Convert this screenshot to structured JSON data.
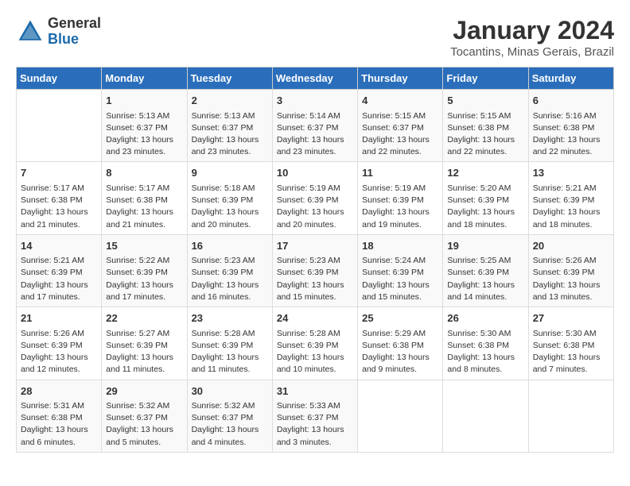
{
  "header": {
    "logo_line1": "General",
    "logo_line2": "Blue",
    "title": "January 2024",
    "subtitle": "Tocantins, Minas Gerais, Brazil"
  },
  "days_of_week": [
    "Sunday",
    "Monday",
    "Tuesday",
    "Wednesday",
    "Thursday",
    "Friday",
    "Saturday"
  ],
  "weeks": [
    [
      {
        "day": "",
        "detail": ""
      },
      {
        "day": "1",
        "detail": "Sunrise: 5:13 AM\nSunset: 6:37 PM\nDaylight: 13 hours\nand 23 minutes."
      },
      {
        "day": "2",
        "detail": "Sunrise: 5:13 AM\nSunset: 6:37 PM\nDaylight: 13 hours\nand 23 minutes."
      },
      {
        "day": "3",
        "detail": "Sunrise: 5:14 AM\nSunset: 6:37 PM\nDaylight: 13 hours\nand 23 minutes."
      },
      {
        "day": "4",
        "detail": "Sunrise: 5:15 AM\nSunset: 6:37 PM\nDaylight: 13 hours\nand 22 minutes."
      },
      {
        "day": "5",
        "detail": "Sunrise: 5:15 AM\nSunset: 6:38 PM\nDaylight: 13 hours\nand 22 minutes."
      },
      {
        "day": "6",
        "detail": "Sunrise: 5:16 AM\nSunset: 6:38 PM\nDaylight: 13 hours\nand 22 minutes."
      }
    ],
    [
      {
        "day": "7",
        "detail": "Sunrise: 5:17 AM\nSunset: 6:38 PM\nDaylight: 13 hours\nand 21 minutes."
      },
      {
        "day": "8",
        "detail": "Sunrise: 5:17 AM\nSunset: 6:38 PM\nDaylight: 13 hours\nand 21 minutes."
      },
      {
        "day": "9",
        "detail": "Sunrise: 5:18 AM\nSunset: 6:39 PM\nDaylight: 13 hours\nand 20 minutes."
      },
      {
        "day": "10",
        "detail": "Sunrise: 5:19 AM\nSunset: 6:39 PM\nDaylight: 13 hours\nand 20 minutes."
      },
      {
        "day": "11",
        "detail": "Sunrise: 5:19 AM\nSunset: 6:39 PM\nDaylight: 13 hours\nand 19 minutes."
      },
      {
        "day": "12",
        "detail": "Sunrise: 5:20 AM\nSunset: 6:39 PM\nDaylight: 13 hours\nand 18 minutes."
      },
      {
        "day": "13",
        "detail": "Sunrise: 5:21 AM\nSunset: 6:39 PM\nDaylight: 13 hours\nand 18 minutes."
      }
    ],
    [
      {
        "day": "14",
        "detail": "Sunrise: 5:21 AM\nSunset: 6:39 PM\nDaylight: 13 hours\nand 17 minutes."
      },
      {
        "day": "15",
        "detail": "Sunrise: 5:22 AM\nSunset: 6:39 PM\nDaylight: 13 hours\nand 17 minutes."
      },
      {
        "day": "16",
        "detail": "Sunrise: 5:23 AM\nSunset: 6:39 PM\nDaylight: 13 hours\nand 16 minutes."
      },
      {
        "day": "17",
        "detail": "Sunrise: 5:23 AM\nSunset: 6:39 PM\nDaylight: 13 hours\nand 15 minutes."
      },
      {
        "day": "18",
        "detail": "Sunrise: 5:24 AM\nSunset: 6:39 PM\nDaylight: 13 hours\nand 15 minutes."
      },
      {
        "day": "19",
        "detail": "Sunrise: 5:25 AM\nSunset: 6:39 PM\nDaylight: 13 hours\nand 14 minutes."
      },
      {
        "day": "20",
        "detail": "Sunrise: 5:26 AM\nSunset: 6:39 PM\nDaylight: 13 hours\nand 13 minutes."
      }
    ],
    [
      {
        "day": "21",
        "detail": "Sunrise: 5:26 AM\nSunset: 6:39 PM\nDaylight: 13 hours\nand 12 minutes."
      },
      {
        "day": "22",
        "detail": "Sunrise: 5:27 AM\nSunset: 6:39 PM\nDaylight: 13 hours\nand 11 minutes."
      },
      {
        "day": "23",
        "detail": "Sunrise: 5:28 AM\nSunset: 6:39 PM\nDaylight: 13 hours\nand 11 minutes."
      },
      {
        "day": "24",
        "detail": "Sunrise: 5:28 AM\nSunset: 6:39 PM\nDaylight: 13 hours\nand 10 minutes."
      },
      {
        "day": "25",
        "detail": "Sunrise: 5:29 AM\nSunset: 6:38 PM\nDaylight: 13 hours\nand 9 minutes."
      },
      {
        "day": "26",
        "detail": "Sunrise: 5:30 AM\nSunset: 6:38 PM\nDaylight: 13 hours\nand 8 minutes."
      },
      {
        "day": "27",
        "detail": "Sunrise: 5:30 AM\nSunset: 6:38 PM\nDaylight: 13 hours\nand 7 minutes."
      }
    ],
    [
      {
        "day": "28",
        "detail": "Sunrise: 5:31 AM\nSunset: 6:38 PM\nDaylight: 13 hours\nand 6 minutes."
      },
      {
        "day": "29",
        "detail": "Sunrise: 5:32 AM\nSunset: 6:37 PM\nDaylight: 13 hours\nand 5 minutes."
      },
      {
        "day": "30",
        "detail": "Sunrise: 5:32 AM\nSunset: 6:37 PM\nDaylight: 13 hours\nand 4 minutes."
      },
      {
        "day": "31",
        "detail": "Sunrise: 5:33 AM\nSunset: 6:37 PM\nDaylight: 13 hours\nand 3 minutes."
      },
      {
        "day": "",
        "detail": ""
      },
      {
        "day": "",
        "detail": ""
      },
      {
        "day": "",
        "detail": ""
      }
    ]
  ]
}
